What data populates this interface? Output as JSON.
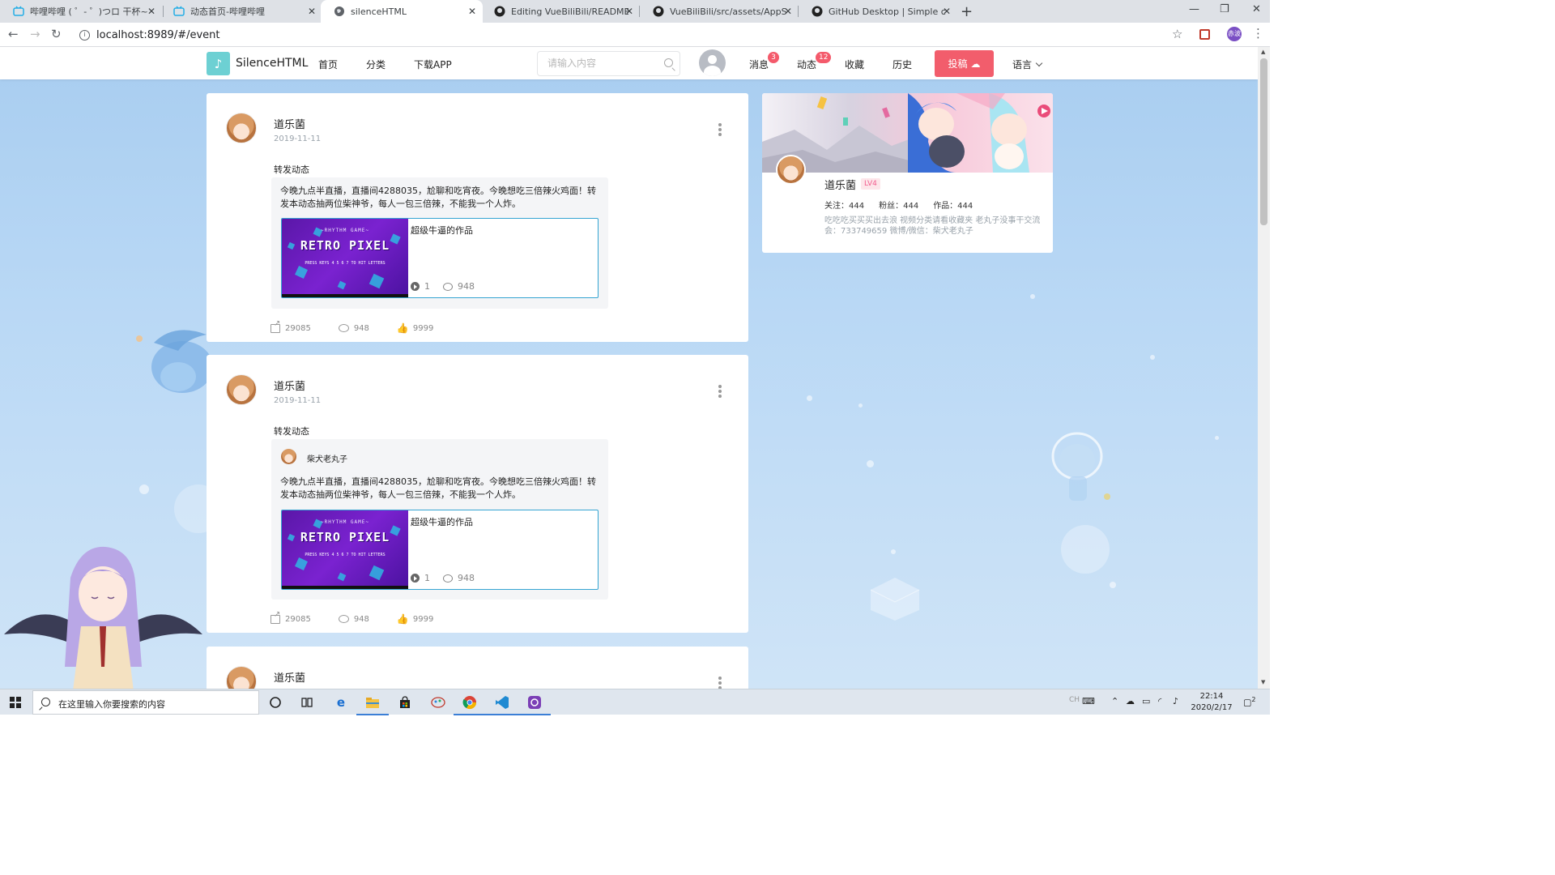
{
  "browser": {
    "tabs": [
      {
        "title": "哔哩哔哩 ( ゜- ゜)つロ 干杯~-bili",
        "favicon": "bilibili-icon"
      },
      {
        "title": "动态首页-哔哩哔哩",
        "favicon": "bilibili-icon"
      },
      {
        "title": "silenceHTML",
        "favicon": "globe-icon",
        "active": true
      },
      {
        "title": "Editing VueBiliBili/README.m",
        "favicon": "github-icon"
      },
      {
        "title": "VueBiliBili/src/assets/AppShot",
        "favicon": "github-icon"
      },
      {
        "title": "GitHub Desktop | Simple colla",
        "favicon": "github-icon"
      }
    ],
    "url": "localhost:8989/#/event",
    "profile_initial": "赤波"
  },
  "nav": {
    "brand": "SilenceHTML",
    "links": [
      "首页",
      "分类",
      "下载APP"
    ],
    "search_placeholder": "请输入内容",
    "messages_label": "消息",
    "messages_badge": "3",
    "dynamic_label": "动态",
    "dynamic_badge": "12",
    "favorites_label": "收藏",
    "history_label": "历史",
    "post_label": "投稿",
    "language_label": "语言"
  },
  "feed": [
    {
      "name": "道乐菌",
      "date": "2019-11-11",
      "action": "转发动态",
      "quote_author": "",
      "text": "今晚九点半直播，直播间4288035，尬聊和吃宵夜。今晚想吃三倍辣火鸡面！转发本动态抽两位柴神爷，每人一包三倍辣，不能我一个人炸。",
      "video": {
        "title": "超级牛逼的作品",
        "plays": "1",
        "comments": "948"
      },
      "shares": "29085",
      "comments": "948",
      "likes": "9999"
    },
    {
      "name": "道乐菌",
      "date": "2019-11-11",
      "action": "转发动态",
      "quote_author": "柴犬老丸子",
      "text": "今晚九点半直播，直播间4288035，尬聊和吃宵夜。今晚想吃三倍辣火鸡面！转发本动态抽两位柴神爷，每人一包三倍辣，不能我一个人炸。",
      "video": {
        "title": "超级牛逼的作品",
        "plays": "1",
        "comments": "948"
      },
      "shares": "29085",
      "comments": "948",
      "likes": "9999"
    },
    {
      "name": "道乐菌"
    }
  ],
  "thumb": {
    "line1": "~RHYTHM GAME~",
    "line2": "RETRO PIXEL",
    "line3": "PRESS KEYS 4 5 6 7 TO HIT LETTERS"
  },
  "profile": {
    "name": "道乐菌",
    "level": "LV4",
    "following": "关注：444",
    "fans": "粉丝：444",
    "works": "作品：444",
    "bio": "吃吃吃买买买出去浪 视频分类请看收藏夹 老丸子没事干交流会：733749659 微博/微信：柴犬老丸子"
  },
  "taskbar": {
    "search_placeholder": "在这里输入你要搜索的内容",
    "ime": "CH",
    "time": "22:14",
    "date": "2020/2/17",
    "notifications": "2"
  },
  "colors": {
    "accent": "#f25d6c",
    "link_blue": "#35a4d2",
    "page_bg": "#b9d8f5"
  }
}
